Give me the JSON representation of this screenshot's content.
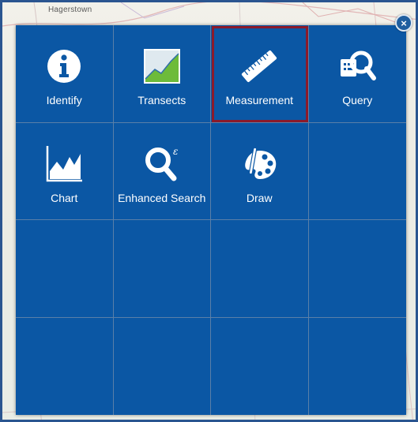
{
  "map": {
    "place_label": "Hagerstown"
  },
  "close_button": {
    "glyph": "×",
    "icon": "close-icon"
  },
  "tools": [
    {
      "label": "Identify",
      "icon": "info-icon",
      "selected": false
    },
    {
      "label": "Transects",
      "icon": "transect-chart-icon",
      "selected": false
    },
    {
      "label": "Measurement",
      "icon": "ruler-icon",
      "selected": true
    },
    {
      "label": "Query",
      "icon": "query-magnifier-icon",
      "selected": false
    },
    {
      "label": "Chart",
      "icon": "area-chart-icon",
      "selected": false
    },
    {
      "label": "Enhanced Search",
      "icon": "enhanced-search-icon",
      "selected": false
    },
    {
      "label": "Draw",
      "icon": "palette-icon",
      "selected": false
    }
  ],
  "colors": {
    "panel": "#0b57a4",
    "selected_outline": "#8b1a2b",
    "cell_border": "#5a7fa8"
  }
}
